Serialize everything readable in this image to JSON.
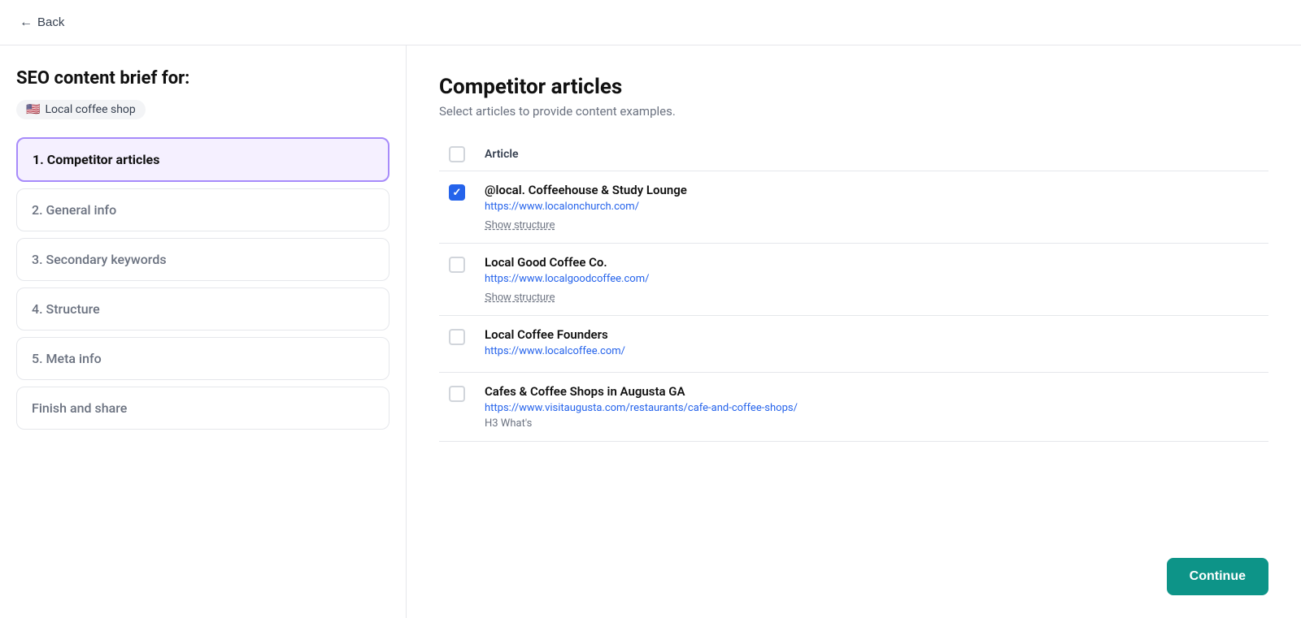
{
  "back": {
    "label": "Back"
  },
  "sidebar": {
    "title": "SEO content brief for:",
    "topic": {
      "flag": "🇺🇸",
      "name": "Local coffee shop"
    },
    "steps": [
      {
        "id": 1,
        "label": "1. Competitor articles",
        "active": true
      },
      {
        "id": 2,
        "label": "2. General info",
        "active": false
      },
      {
        "id": 3,
        "label": "3. Secondary keywords",
        "active": false
      },
      {
        "id": 4,
        "label": "4. Structure",
        "active": false
      },
      {
        "id": 5,
        "label": "5. Meta info",
        "active": false
      },
      {
        "id": 6,
        "label": "Finish and share",
        "active": false
      }
    ]
  },
  "main": {
    "title": "Competitor articles",
    "subtitle": "Select articles to provide content examples.",
    "header": {
      "article_col": "Article"
    },
    "articles": [
      {
        "id": 1,
        "checked": false,
        "name": "@local. Coffeehouse & Study Lounge",
        "url": "https://www.localonchurch.com/",
        "show_structure": true,
        "extra": null
      },
      {
        "id": 2,
        "checked": false,
        "name": "Local Good Coffee Co.",
        "url": "https://www.localgoodcoffee.com/",
        "show_structure": true,
        "extra": null
      },
      {
        "id": 3,
        "checked": false,
        "name": "Local Coffee Founders",
        "url": "https://www.localcoffee.com/",
        "show_structure": false,
        "extra": null
      },
      {
        "id": 4,
        "checked": false,
        "name": "Cafes & Coffee Shops in Augusta GA",
        "url": "https://www.visitaugusta.com/restaurants/cafe-and-coffee-shops/",
        "show_structure": false,
        "extra": "H3 What's"
      }
    ],
    "checked_article_id": 1
  },
  "continue_btn": {
    "label": "Continue"
  }
}
